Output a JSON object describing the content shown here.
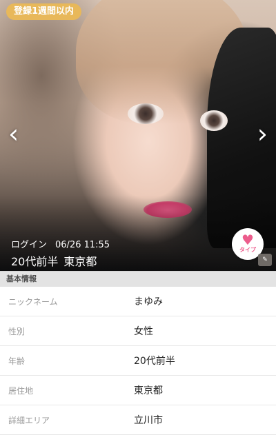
{
  "photo": {
    "badge": "登録1週間以内",
    "prev_icon": "chevron-left-icon",
    "next_icon": "chevron-right-icon",
    "login_label": "ログイン",
    "login_time": "06/26 11:55",
    "age": "20代前半",
    "location": "東京都",
    "type_button": {
      "icon": "heart-icon",
      "label": "タイプ",
      "color": "#ec5c8c"
    },
    "badge_color": "#e8b85a"
  },
  "basic_info": {
    "header": "基本情報",
    "rows": [
      {
        "label": "ニックネーム",
        "value": "まゆみ"
      },
      {
        "label": "性別",
        "value": "女性"
      },
      {
        "label": "年齢",
        "value": "20代前半"
      },
      {
        "label": "居住地",
        "value": "東京都"
      },
      {
        "label": "詳細エリア",
        "value": "立川市"
      }
    ]
  }
}
